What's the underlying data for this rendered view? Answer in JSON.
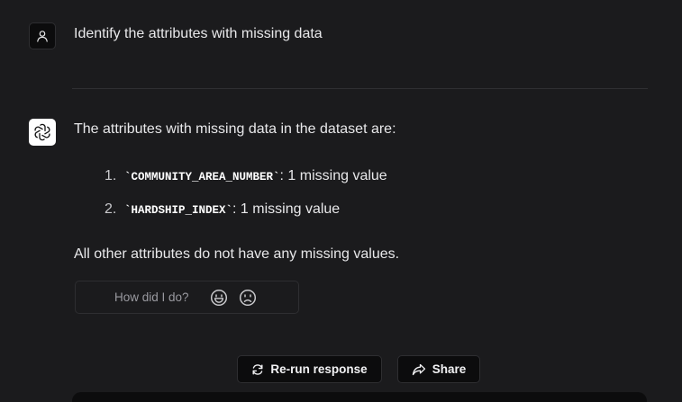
{
  "conversation": {
    "user_message": "Identify the attributes with missing data",
    "assistant": {
      "intro": "The attributes with missing data in the dataset are:",
      "items": [
        {
          "number": "1.",
          "code": "`COMMUNITY_AREA_NUMBER`",
          "text": ": 1 missing value"
        },
        {
          "number": "2.",
          "code": "`HARDSHIP_INDEX`",
          "text": ": 1 missing value"
        }
      ],
      "outro": "All other attributes do not have any missing values."
    }
  },
  "feedback": {
    "prompt": "How did I do?",
    "positive_icon": "smile-icon",
    "negative_icon": "frown-icon"
  },
  "actions": {
    "rerun_label": "Re-run response",
    "share_label": "Share",
    "rerun_icon": "refresh-icon",
    "share_icon": "share-arrow-icon"
  },
  "colors": {
    "background": "#1b1b1d",
    "text": "#e8e8ea",
    "muted": "#9a9aa0",
    "border": "#2e2e31",
    "button_bg": "#0c0c0d"
  }
}
